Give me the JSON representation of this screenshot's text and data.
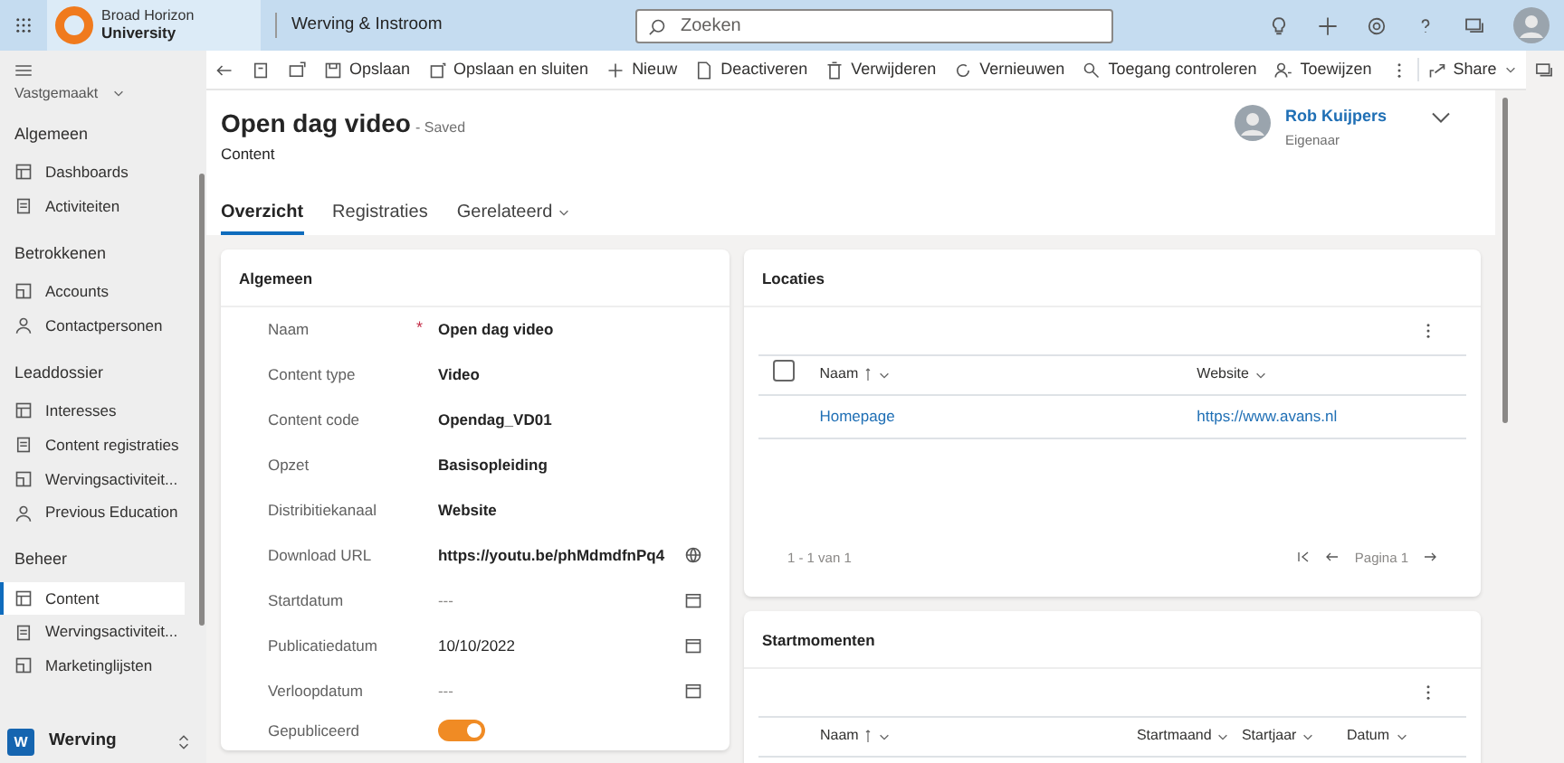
{
  "header": {
    "brand_line_1": "Broad Horizon",
    "brand_line_2": "University",
    "app_title": "Werving & Instroom",
    "search": {
      "placeholder": "Zoeken"
    }
  },
  "sidebar": {
    "pinned": "Vastgemaakt",
    "groups": [
      {
        "title": "Algemeen",
        "items": [
          {
            "label": "Dashboards",
            "selected": false
          },
          {
            "label": "Activiteiten",
            "selected": false
          }
        ]
      },
      {
        "title": "Betrokkenen",
        "items": [
          {
            "label": "Accounts",
            "selected": false
          },
          {
            "label": "Contactpersonen",
            "selected": false
          }
        ]
      },
      {
        "title": "Leaddossier",
        "items": [
          {
            "label": "Interesses",
            "selected": false
          },
          {
            "label": "Content registraties",
            "selected": false
          },
          {
            "label": "Wervingsactiviteit...",
            "selected": false
          },
          {
            "label": "Previous Education",
            "selected": false
          }
        ]
      },
      {
        "title": "Beheer",
        "items": [
          {
            "label": "Content",
            "selected": true
          },
          {
            "label": "Wervingsactiviteit...",
            "selected": false
          },
          {
            "label": "Marketinglijsten",
            "selected": false
          }
        ]
      }
    ],
    "area": {
      "badge": "W",
      "label": "Werving"
    }
  },
  "command_bar": {
    "buttons": [
      "Opslaan",
      "Opslaan en sluiten",
      "Nieuw",
      "Deactiveren",
      "Verwijderen",
      "Vernieuwen",
      "Toegang controleren",
      "Toewijzen"
    ],
    "share": "Share"
  },
  "record": {
    "title": "Open dag video",
    "status": "- Saved",
    "entity": "Content",
    "owner_name": "Rob Kuijpers",
    "owner_role": "Eigenaar"
  },
  "tabs": [
    {
      "label": "Overzicht",
      "selected": true,
      "kind": "tab"
    },
    {
      "label": "Registraties",
      "selected": false,
      "kind": "tab"
    },
    {
      "label": "Gerelateerd",
      "selected": false,
      "kind": "dropdown"
    }
  ],
  "general": {
    "title": "Algemeen",
    "required_mark": "*",
    "fields": [
      {
        "label": "Naam",
        "value": "Open dag video",
        "required": true,
        "kind": "text"
      },
      {
        "label": "Content type",
        "value": "Video",
        "required": false,
        "kind": "text"
      },
      {
        "label": "Content code",
        "value": "Opendag_VD01",
        "required": false,
        "kind": "text"
      },
      {
        "label": "Opzet",
        "value": "Basisopleiding",
        "required": false,
        "kind": "text"
      },
      {
        "label": "Distribitiekanaal",
        "value": "Website",
        "required": false,
        "kind": "text"
      },
      {
        "label": "Download URL",
        "value": "https://youtu.be/phMdmdfnPq4",
        "required": false,
        "kind": "url"
      },
      {
        "label": "Startdatum",
        "placeholder": "---",
        "required": false,
        "kind": "date"
      },
      {
        "label": "Publicatiedatum",
        "value": "10/10/2022",
        "required": false,
        "kind": "date"
      },
      {
        "label": "Verloopdatum",
        "placeholder": "---",
        "required": false,
        "kind": "date"
      },
      {
        "label": "Gepubliceerd",
        "on": true,
        "required": false,
        "kind": "toggle"
      }
    ]
  },
  "locaties": {
    "title": "Locaties",
    "select_all": {
      "checked": false
    },
    "columns": [
      {
        "label": "Naam",
        "sorted": true
      },
      {
        "label": "Website",
        "sorted": false
      }
    ],
    "rows": [
      [
        "Homepage",
        "https://www.avans.nl"
      ]
    ],
    "count": "1 - 1 van 1",
    "page": "Pagina 1"
  },
  "startmomenten": {
    "title": "Startmomenten",
    "columns": [
      {
        "label": "Naam",
        "sorted": true
      },
      {
        "label": "Startmaand",
        "sorted": false
      },
      {
        "label": "Startjaar",
        "sorted": false
      },
      {
        "label": "Datum",
        "sorted": false
      }
    ]
  }
}
